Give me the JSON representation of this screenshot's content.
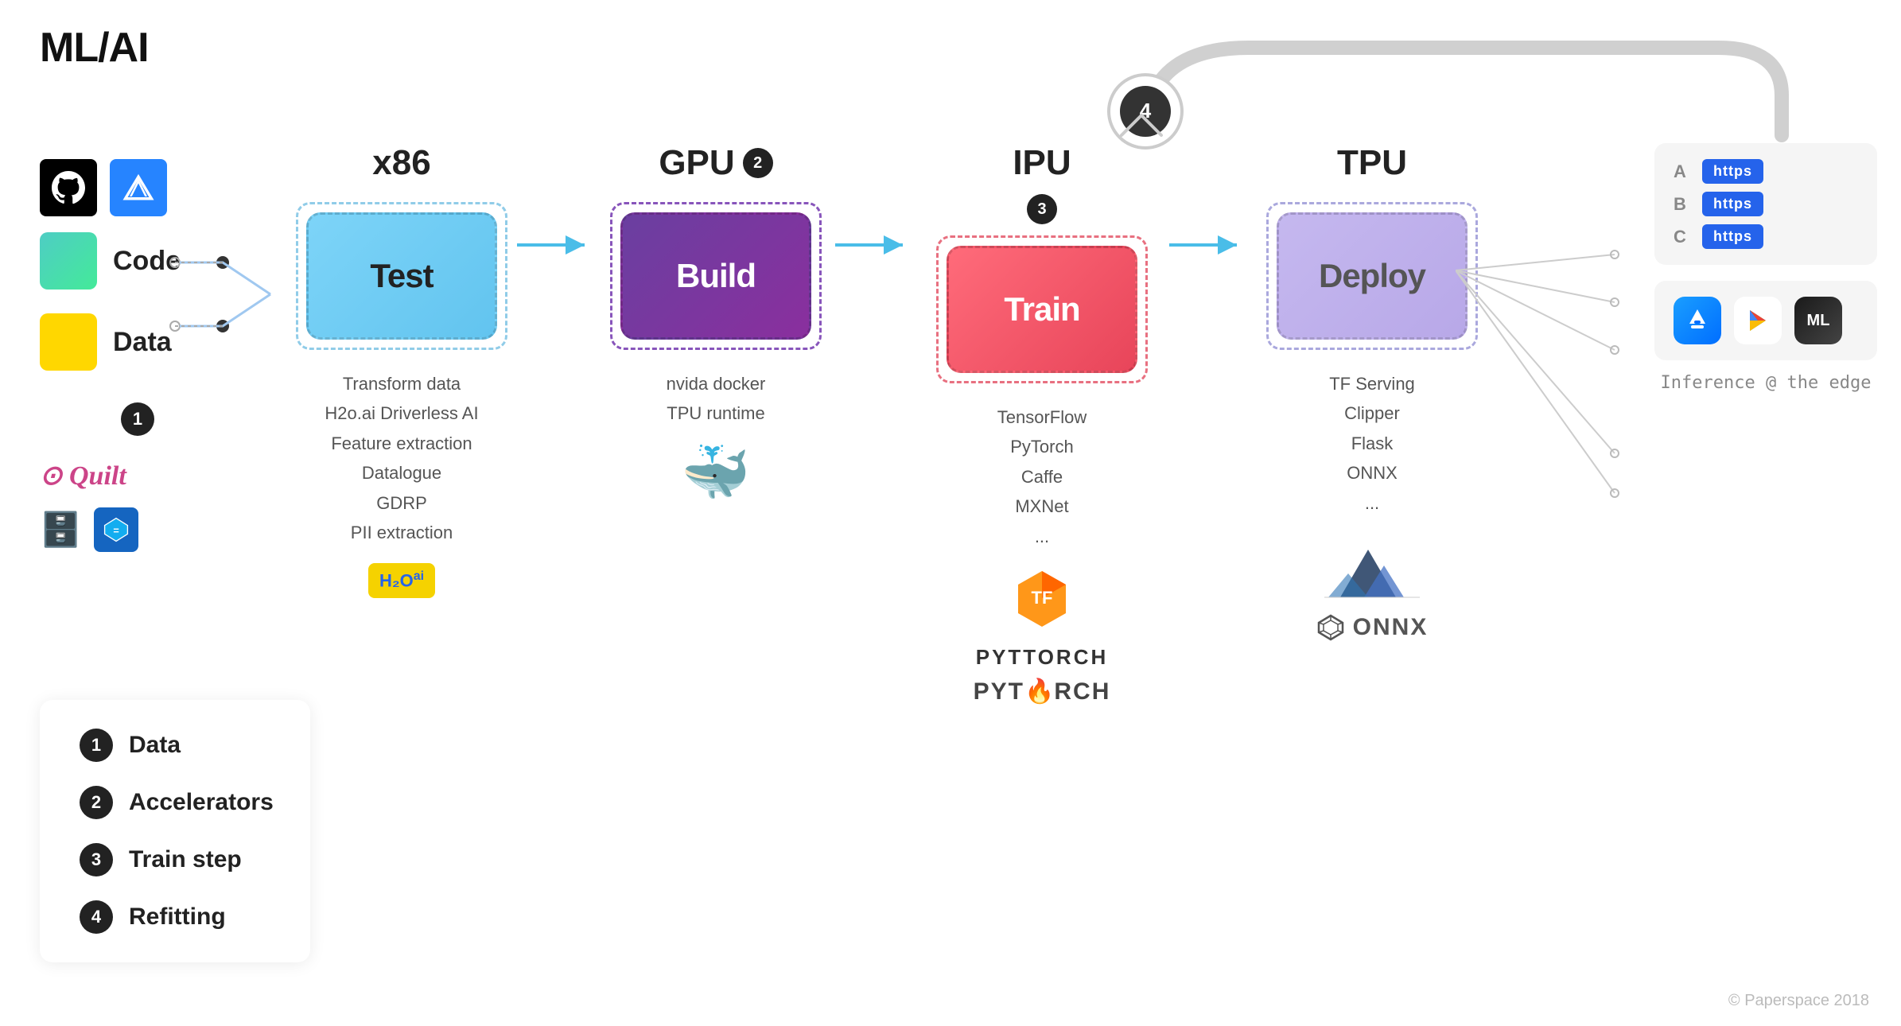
{
  "title": "ML/AI",
  "copyright": "© Paperspace 2018",
  "refitting_number": "4",
  "sources": {
    "code_label": "Code",
    "data_label": "Data",
    "badge": "1",
    "quilt_label": "Quilt"
  },
  "stages": [
    {
      "id": "test",
      "heading": "x86",
      "badge": null,
      "box_label": "Test",
      "notes": [
        "Transform data",
        "H2o.ai Driverless AI",
        "Feature extraction",
        "Datalogue",
        "GDRP",
        "PII extraction"
      ],
      "icon_label": "H₂O ai"
    },
    {
      "id": "build",
      "heading": "GPU",
      "badge": "2",
      "box_label": "Build",
      "notes": [
        "nvida docker",
        "TPU runtime"
      ],
      "icon_label": "docker"
    },
    {
      "id": "train",
      "heading": "IPU",
      "badge": null,
      "box_label": "Train",
      "notes": [
        "TensorFlow",
        "PyTorch",
        "Caffe",
        "MXNet",
        "..."
      ],
      "badge_below": "3",
      "icon_label": "pytorch"
    },
    {
      "id": "deploy",
      "heading": "TPU",
      "badge": null,
      "box_label": "Deploy",
      "notes": [
        "TF Serving",
        "Clipper",
        "Flask",
        "ONNX",
        "..."
      ],
      "icon_label": "onnx"
    }
  ],
  "legend": {
    "items": [
      {
        "number": "1",
        "label": "Data"
      },
      {
        "number": "2",
        "label": "Accelerators"
      },
      {
        "number": "3",
        "label": "Train step"
      },
      {
        "number": "4",
        "label": "Refitting"
      }
    ]
  },
  "inference": {
    "label": "Inference @ the edge",
    "endpoints": [
      {
        "letter": "A",
        "badge": "https"
      },
      {
        "letter": "B",
        "badge": "https"
      },
      {
        "letter": "C",
        "badge": "https"
      }
    ]
  }
}
